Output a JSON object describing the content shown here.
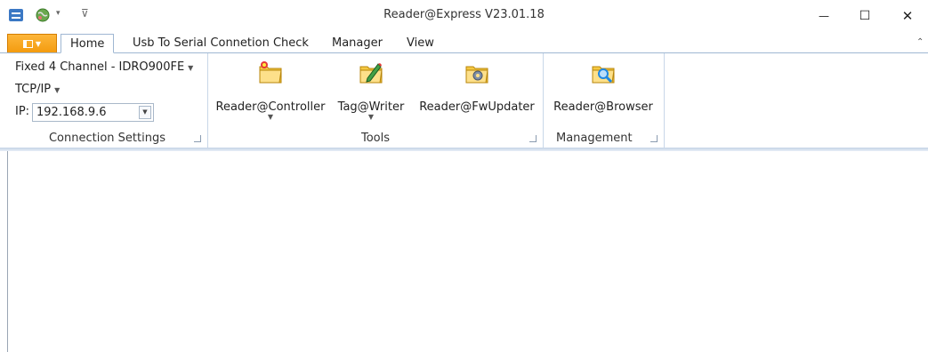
{
  "window": {
    "title": "Reader@Express V23.01.18",
    "minimize": "—",
    "maximize": "☐",
    "close": "✕"
  },
  "quick_access": {
    "dropdown": "▾",
    "customize": "⊽"
  },
  "tabs": [
    {
      "label": "Home",
      "active": true
    },
    {
      "label": "Usb To Serial Connetion Check",
      "active": false
    },
    {
      "label": "Manager",
      "active": false
    },
    {
      "label": "View",
      "active": false
    }
  ],
  "connection": {
    "device": "Fixed 4 Channel - IDRO900FE",
    "protocol": "TCP/IP",
    "ip_label": "IP:",
    "ip_value": "192.168.9.6",
    "group_label": "Connection Settings"
  },
  "tools": {
    "group_label": "Tools",
    "items": [
      {
        "label": "Reader@Controller",
        "has_dropdown": true,
        "icon": "folder-star-icon"
      },
      {
        "label": "Tag@Writer",
        "has_dropdown": true,
        "icon": "folder-pencil-icon"
      },
      {
        "label": "Reader@FwUpdater",
        "has_dropdown": false,
        "icon": "folder-gear-icon"
      }
    ]
  },
  "management": {
    "group_label": "Management",
    "items": [
      {
        "label": "Reader@Browser",
        "icon": "folder-search-icon"
      }
    ]
  },
  "colors": {
    "app_menu": "#f39a0d",
    "ribbon_border": "#9fb7d2",
    "folder": "#f5c842"
  }
}
